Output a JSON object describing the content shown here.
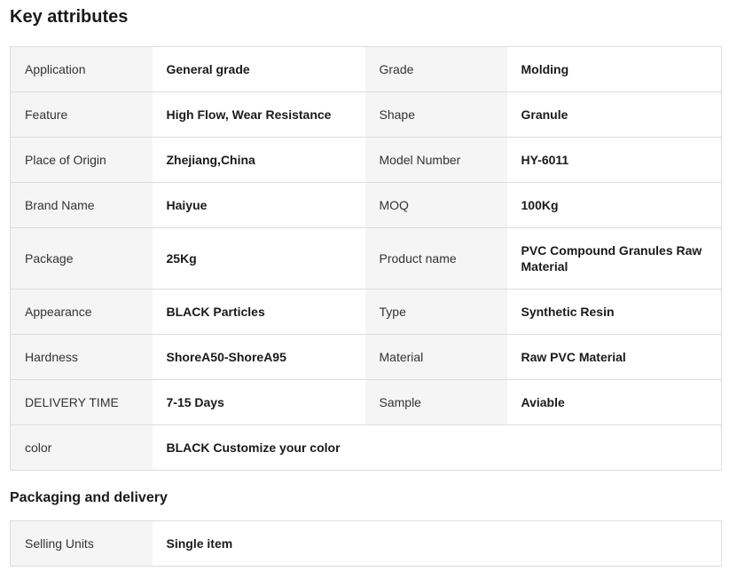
{
  "key_attributes": {
    "title": "Key attributes",
    "rows": [
      {
        "l1": "Application",
        "v1": "General grade",
        "l2": "Grade",
        "v2": "Molding"
      },
      {
        "l1": "Feature",
        "v1": "High Flow, Wear Resistance",
        "l2": "Shape",
        "v2": "Granule"
      },
      {
        "l1": "Place of Origin",
        "v1": "Zhejiang,China",
        "l2": "Model Number",
        "v2": "HY-6011"
      },
      {
        "l1": "Brand Name",
        "v1": "Haiyue",
        "l2": "MOQ",
        "v2": "100Kg"
      },
      {
        "l1": "Package",
        "v1": "25Kg",
        "l2": "Product name",
        "v2": "PVC Compound Granules Raw Material"
      },
      {
        "l1": "Appearance",
        "v1": "BLACK Particles",
        "l2": "Type",
        "v2": "Synthetic Resin"
      },
      {
        "l1": "Hardness",
        "v1": "ShoreA50-ShoreA95",
        "l2": "Material",
        "v2": "Raw PVC Material"
      },
      {
        "l1": "DELIVERY TIME",
        "v1": "7-15 Days",
        "l2": "Sample",
        "v2": "Aviable"
      },
      {
        "l1": "color",
        "v1": "BLACK Customize your color"
      }
    ]
  },
  "packaging": {
    "title": "Packaging and delivery",
    "rows": [
      {
        "l1": "Selling Units",
        "v1": "Single item"
      }
    ]
  }
}
